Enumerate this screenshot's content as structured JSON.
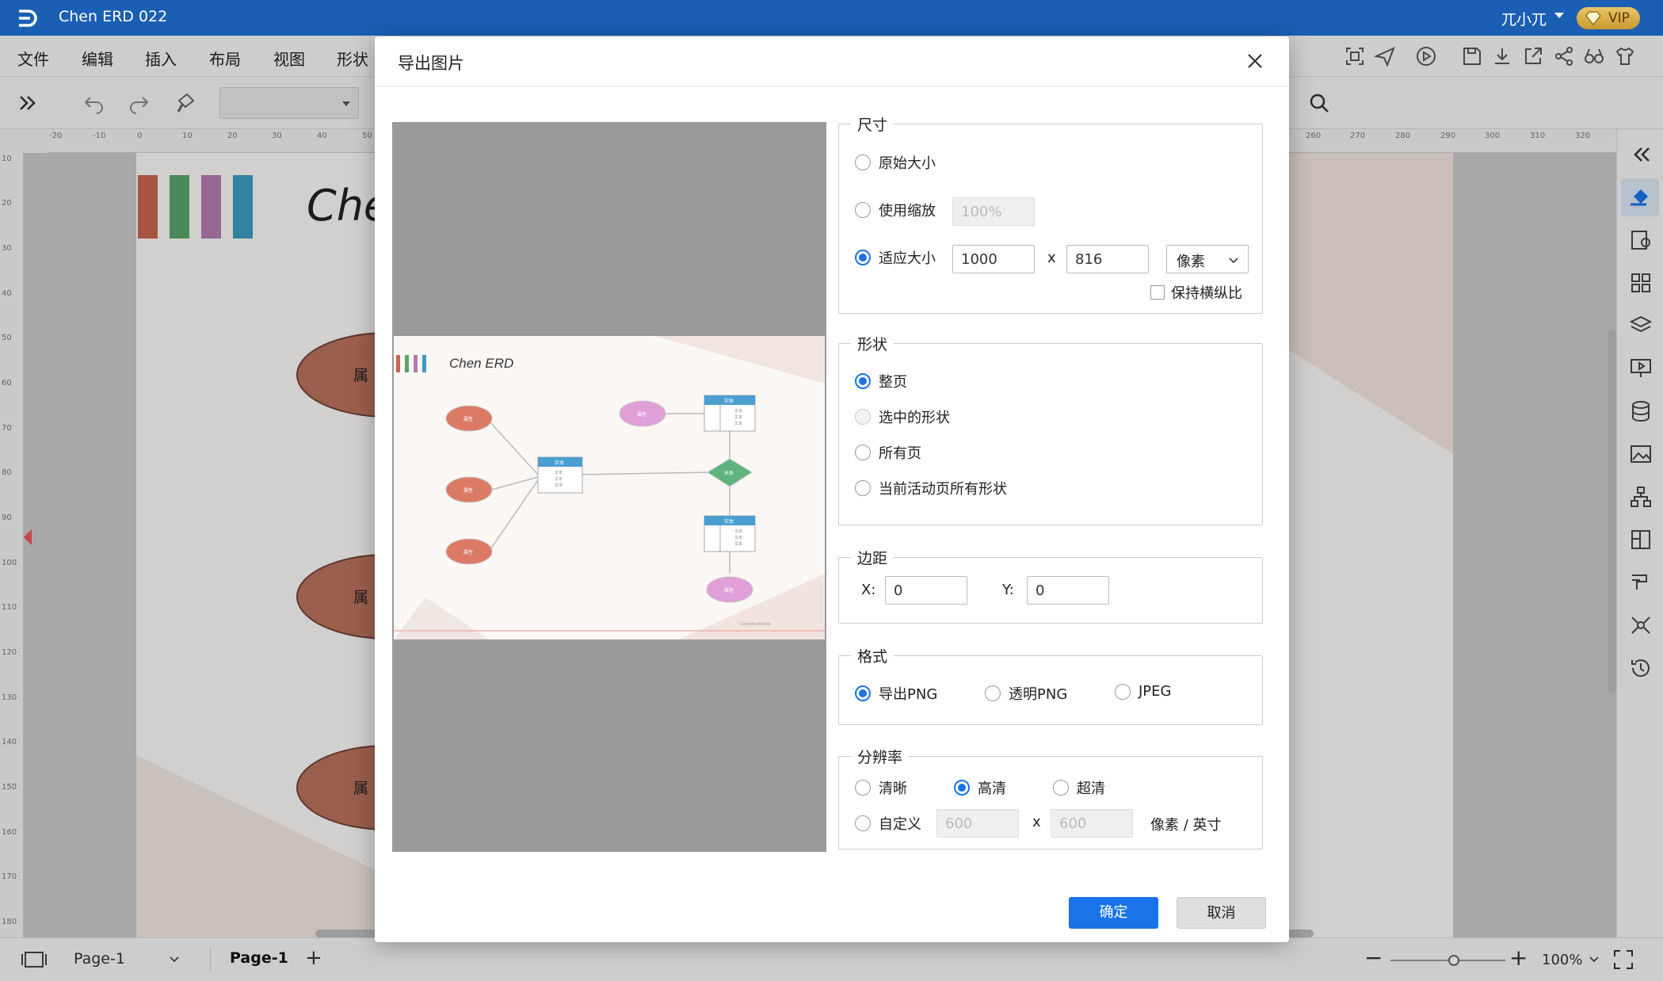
{
  "app": {
    "title": "Chen ERD 022",
    "user": "兀小兀",
    "vip_label": "VIP",
    "accent": "#1a5fb4"
  },
  "menu": [
    "文件",
    "编辑",
    "插入",
    "布局",
    "视图",
    "形状"
  ],
  "ruler_top": [
    "-20",
    "-10",
    "0",
    "10",
    "20",
    "30",
    "40",
    "50",
    "260",
    "270",
    "280",
    "290",
    "300",
    "310",
    "320"
  ],
  "ruler_left": [
    "10",
    "20",
    "30",
    "40",
    "50",
    "60",
    "70",
    "80",
    "90",
    "100",
    "110",
    "120",
    "130",
    "140",
    "150",
    "160",
    "170",
    "180"
  ],
  "canvas": {
    "heading": "Che",
    "attr_label": "属",
    "color_bars": [
      "#c8664f",
      "#5aa469",
      "#b37ab2",
      "#3d9bc0"
    ]
  },
  "dialog": {
    "title": "导出图片",
    "size": {
      "legend": "尺寸",
      "original": "原始大小",
      "use_zoom": "使用缩放",
      "zoom_value": "100%",
      "fit": "适应大小",
      "width": "1000",
      "height": "816",
      "times": "x",
      "unit": "像素",
      "keep_ratio": "保持横纵比",
      "selected": "fit"
    },
    "shape": {
      "legend": "形状",
      "options": [
        "整页",
        "选中的形状",
        "所有页",
        "当前活动页所有形状"
      ],
      "selected": "整页"
    },
    "margin": {
      "legend": "边距",
      "x_label": "X:",
      "x_value": "0",
      "y_label": "Y:",
      "y_value": "0"
    },
    "format": {
      "legend": "格式",
      "options": [
        "导出PNG",
        "透明PNG",
        "JPEG"
      ],
      "selected": "导出PNG"
    },
    "resolution": {
      "legend": "分辨率",
      "options": [
        "清晰",
        "高清",
        "超清"
      ],
      "selected": "高清",
      "custom": "自定义",
      "custom_w": "600",
      "custom_h": "600",
      "times": "x",
      "unit": "像素 / 英寸"
    },
    "ok": "确定",
    "cancel": "取消",
    "preview": {
      "title": "Chen ERD",
      "attr": "属性",
      "entity": "实体",
      "row": "文本",
      "relation": "关系",
      "footer": "CompanyName"
    }
  },
  "status": {
    "page_select": "Page-1",
    "page_tab": "Page-1",
    "add": "+",
    "zoom": "100%",
    "zoom_level": 0.55,
    "minus": "−",
    "plus": "+"
  }
}
